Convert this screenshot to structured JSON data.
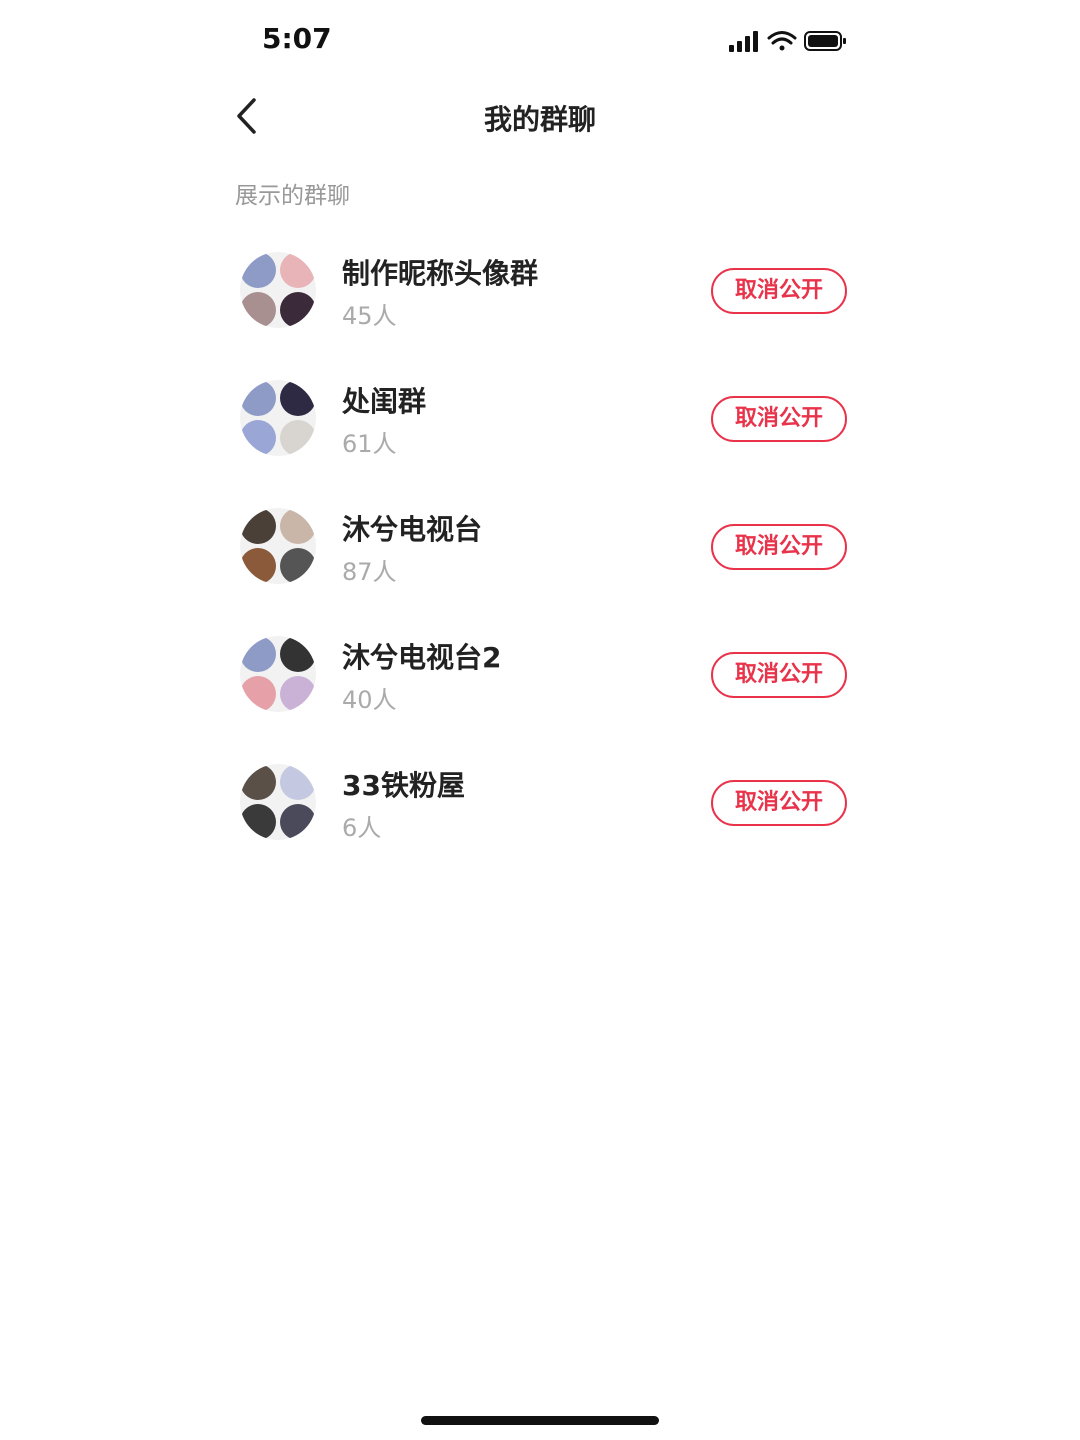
{
  "status_bar": {
    "time": "5:07"
  },
  "nav": {
    "title": "我的群聊"
  },
  "section": {
    "title": "展示的群聊"
  },
  "button_label": "取消公开",
  "groups": [
    {
      "name": "制作昵称头像群",
      "count": "45人",
      "avatar_colors": [
        "#8e9bc7",
        "#e8b4b8",
        "#a89090",
        "#3b2a3a"
      ]
    },
    {
      "name": "处闺群",
      "count": "61人",
      "avatar_colors": [
        "#8e9bc7",
        "#2e2a44",
        "#9aa6d6",
        "#d8d4d0"
      ]
    },
    {
      "name": "沐兮电视台",
      "count": "87人",
      "avatar_colors": [
        "#4a4038",
        "#c9b6a8",
        "#8a5a3a",
        "#555555"
      ]
    },
    {
      "name": "沐兮电视台2",
      "count": "40人",
      "avatar_colors": [
        "#8e9bc7",
        "#333333",
        "#e6a0a8",
        "#c9b2d6"
      ]
    },
    {
      "name": "33铁粉屋",
      "count": "6人",
      "avatar_colors": [
        "#5a5048",
        "#c4c8e0",
        "#3a3a3a",
        "#4a4a5a"
      ]
    }
  ]
}
